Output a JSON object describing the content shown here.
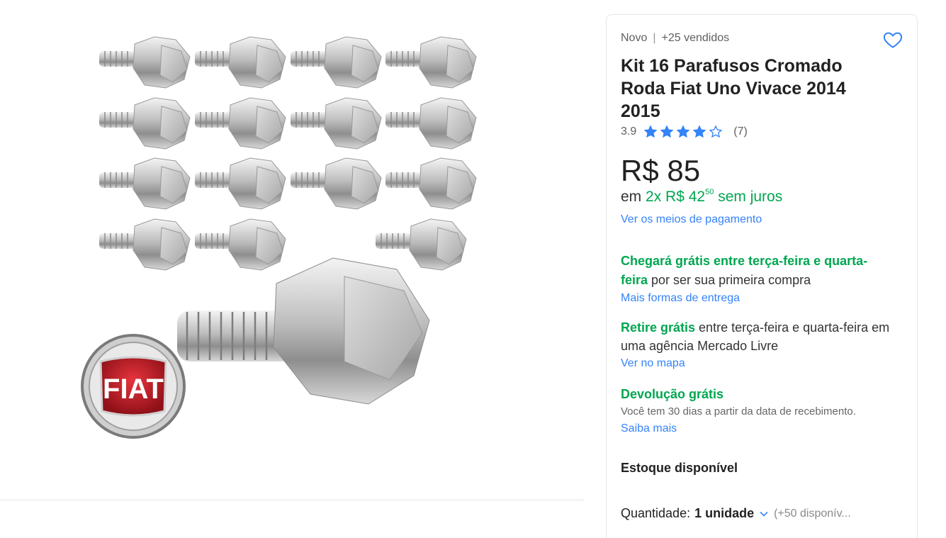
{
  "product": {
    "condition": "Novo",
    "sold": "+25 vendidos",
    "title": "Kit 16 Parafusos Cromado Roda Fiat Uno Vivace 2014 2015",
    "rating_value": "3.9",
    "rating_stars": 3.9,
    "review_count": "(7)",
    "image_logo_text": "FIAT"
  },
  "pricing": {
    "price": "R$ 85",
    "installments_prefix": "em",
    "installments_count": "2x R$ 42",
    "installments_cents": "50",
    "installments_suffix": "sem juros",
    "payment_link": "Ver os meios de pagamento"
  },
  "shipping": {
    "delivery_green": "Chegará grátis entre terça-feira e quarta-feira",
    "delivery_rest": " por ser sua primeira compra",
    "delivery_link": "Mais formas de entrega",
    "pickup_green": "Retire grátis",
    "pickup_rest": " entre terça-feira e quarta-feira em uma agência Mercado Livre",
    "pickup_link": "Ver no mapa",
    "returns_title": "Devolução grátis",
    "returns_text": "Você tem 30 dias a partir da data de recebimento.",
    "returns_link": "Saiba mais"
  },
  "stock": {
    "label": "Estoque disponível",
    "qty_label": "Quantidade:",
    "qty_value": "1 unidade",
    "available": "(+50 disponív..."
  },
  "icons": {
    "favorite": "heart-icon",
    "star": "star-icon",
    "dropdown": "chevron-down-icon"
  },
  "colors": {
    "accent_blue": "#3483fa",
    "success_green": "#00a650"
  }
}
